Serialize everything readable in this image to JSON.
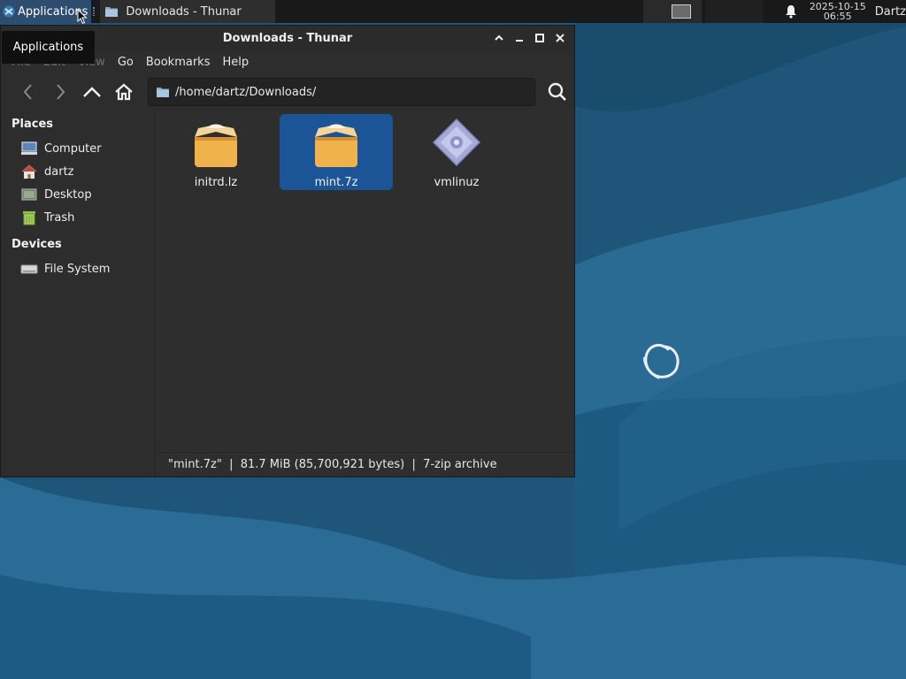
{
  "panel": {
    "applications_label": "Applications",
    "task_title": "Downloads - Thunar",
    "clock_date": "2025-10-15",
    "clock_time": "06:55",
    "user": "Dartz"
  },
  "tooltip": {
    "text": "Applications"
  },
  "window": {
    "title": "Downloads - Thunar",
    "menu": [
      "File",
      "Edit",
      "View",
      "Go",
      "Bookmarks",
      "Help"
    ],
    "location": "/home/dartz/Downloads/",
    "sidebar": {
      "places_heading": "Places",
      "places": [
        {
          "label": "Computer",
          "icon": "computer-icon"
        },
        {
          "label": "dartz",
          "icon": "home-folder-icon"
        },
        {
          "label": "Desktop",
          "icon": "desktop-icon"
        },
        {
          "label": "Trash",
          "icon": "trash-icon"
        }
      ],
      "devices_heading": "Devices",
      "devices": [
        {
          "label": "File System",
          "icon": "drive-icon"
        }
      ]
    },
    "files": [
      {
        "name": "initrd.lz",
        "icon": "archive-icon",
        "selected": false
      },
      {
        "name": "mint.7z",
        "icon": "archive-icon",
        "selected": true
      },
      {
        "name": "vmlinuz",
        "icon": "binary-icon",
        "selected": false
      }
    ],
    "status": "\"mint.7z\"  |  81.7 MiB (85,700,921 bytes)  |  7-zip archive"
  },
  "colors": {
    "desktop": "#1f5a80",
    "selection": "#1b5497",
    "panel": "#191919"
  }
}
